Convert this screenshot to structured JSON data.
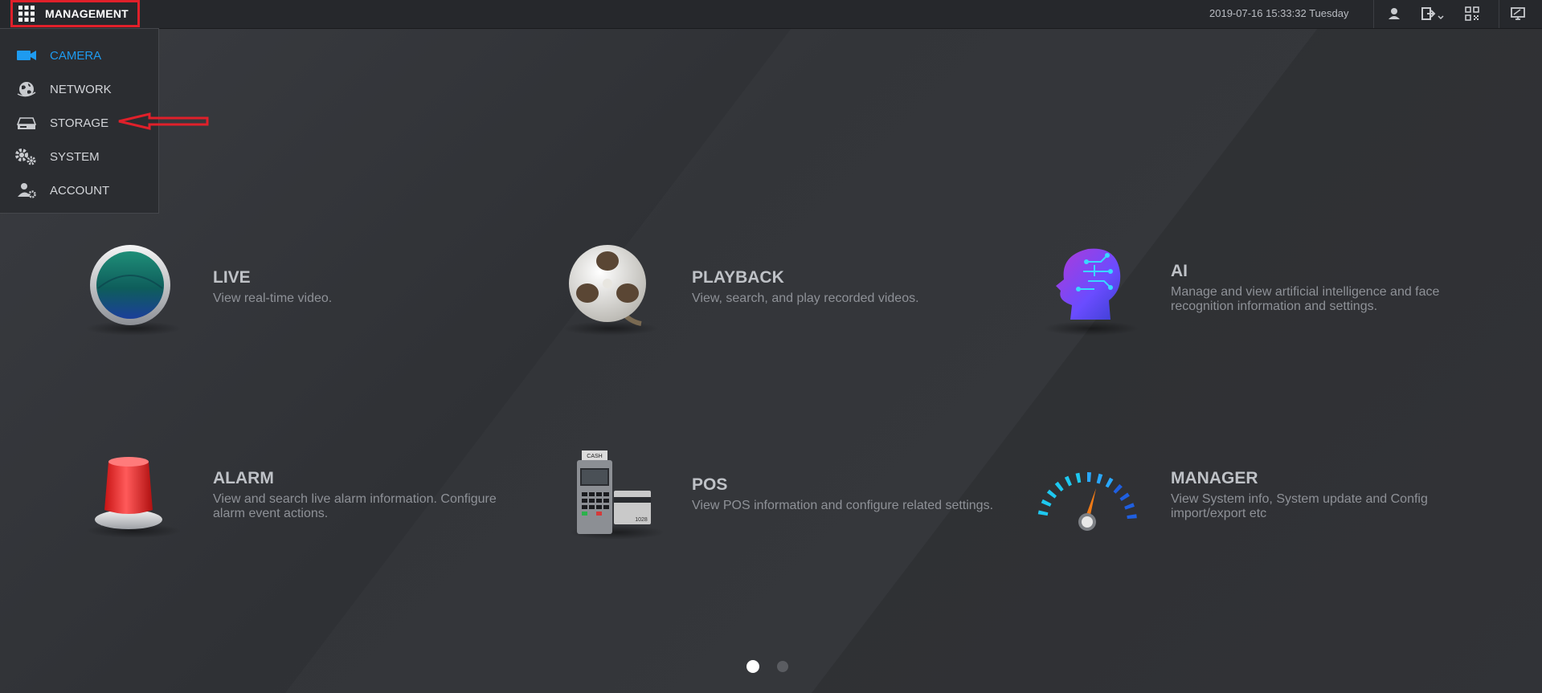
{
  "topbar": {
    "menu_button_label": "MANAGEMENT",
    "datetime": "2019-07-16 15:33:32 Tuesday",
    "icons": [
      "user-icon",
      "logout-icon",
      "qr-code-icon",
      "display-icon"
    ]
  },
  "menu": {
    "items": [
      {
        "label": "CAMERA",
        "icon": "camera-icon",
        "active": true
      },
      {
        "label": "NETWORK",
        "icon": "network-globe-icon",
        "active": false
      },
      {
        "label": "STORAGE",
        "icon": "storage-drive-icon",
        "active": false
      },
      {
        "label": "SYSTEM",
        "icon": "gears-icon",
        "active": false
      },
      {
        "label": "ACCOUNT",
        "icon": "account-icon",
        "active": false
      }
    ]
  },
  "tiles": [
    {
      "title": "LIVE",
      "desc": "View real-time video.",
      "icon": "live-lens-icon"
    },
    {
      "title": "PLAYBACK",
      "desc": "View, search, and play recorded videos.",
      "icon": "film-reel-icon"
    },
    {
      "title": "AI",
      "desc": "Manage and view artificial intelligence and face recognition information and settings.",
      "icon": "ai-head-icon"
    },
    {
      "title": "ALARM",
      "desc": "View and search live alarm information. Configure alarm event actions.",
      "icon": "alarm-siren-icon"
    },
    {
      "title": "POS",
      "desc": "View POS information and configure related settings.",
      "icon": "pos-terminal-icon",
      "terminal_label": "CASH",
      "card_number": "1028"
    },
    {
      "title": "MANAGER",
      "desc": "View System info, System update and Config import/export etc",
      "icon": "gauge-icon"
    }
  ],
  "pagination": {
    "current": 1,
    "total": 2
  },
  "colors": {
    "accent": "#1e9bf0",
    "highlight_border": "#e0202a",
    "annotation_arrow": "#e0202a"
  }
}
